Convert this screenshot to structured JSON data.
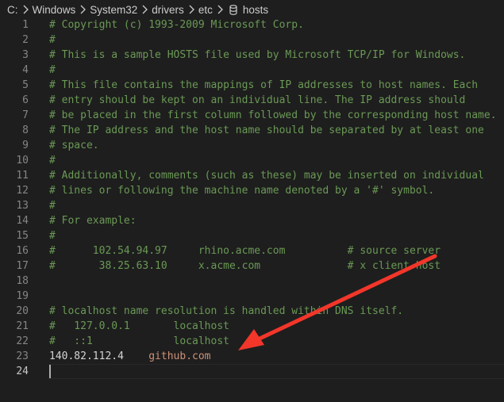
{
  "breadcrumb": {
    "items": [
      "C:",
      "Windows",
      "System32",
      "drivers",
      "etc"
    ],
    "file": "hosts",
    "file_icon": "database-icon",
    "separator_icon": "chevron-right-icon"
  },
  "editor": {
    "lines": [
      {
        "num": "1",
        "text": "# Copyright (c) 1993-2009 Microsoft Corp."
      },
      {
        "num": "2",
        "text": "#"
      },
      {
        "num": "3",
        "text": "# This is a sample HOSTS file used by Microsoft TCP/IP for Windows."
      },
      {
        "num": "4",
        "text": "#"
      },
      {
        "num": "5",
        "text": "# This file contains the mappings of IP addresses to host names. Each"
      },
      {
        "num": "6",
        "text": "# entry should be kept on an individual line. The IP address should"
      },
      {
        "num": "7",
        "text": "# be placed in the first column followed by the corresponding host name."
      },
      {
        "num": "8",
        "text": "# The IP address and the host name should be separated by at least one"
      },
      {
        "num": "9",
        "text": "# space."
      },
      {
        "num": "10",
        "text": "#"
      },
      {
        "num": "11",
        "text": "# Additionally, comments (such as these) may be inserted on individual"
      },
      {
        "num": "12",
        "text": "# lines or following the machine name denoted by a '#' symbol."
      },
      {
        "num": "13",
        "text": "#"
      },
      {
        "num": "14",
        "text": "# For example:"
      },
      {
        "num": "15",
        "text": "#"
      },
      {
        "num": "16",
        "text": "#      102.54.94.97     rhino.acme.com          # source server"
      },
      {
        "num": "17",
        "text": "#       38.25.63.10     x.acme.com              # x client host"
      },
      {
        "num": "18",
        "text": ""
      },
      {
        "num": "19",
        "text": ""
      },
      {
        "num": "20",
        "text": "# localhost name resolution is handled within DNS itself."
      },
      {
        "num": "21",
        "text": "#   127.0.0.1       localhost"
      },
      {
        "num": "22",
        "text": "#   ::1             localhost"
      }
    ],
    "entry": {
      "num": "23",
      "ip": "140.82.112.4",
      "gap": "    ",
      "host": "github.com"
    },
    "current": {
      "num": "24"
    }
  },
  "colors": {
    "background": "#1e1e1e",
    "comment": "#6a9955",
    "string": "#ce9178",
    "annotation_arrow": "#f2362a"
  }
}
